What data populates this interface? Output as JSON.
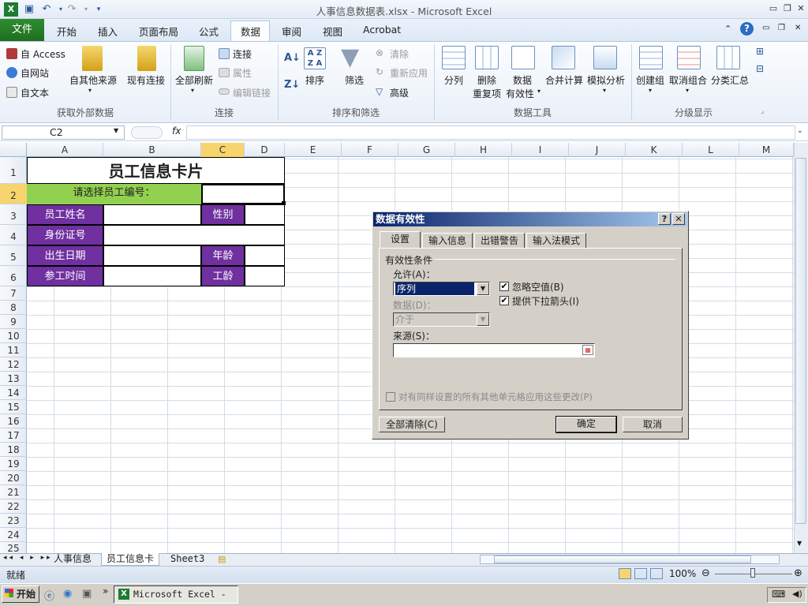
{
  "window": {
    "title": "人事信息数据表.xlsx - Microsoft Excel"
  },
  "ribbon": {
    "tabs": [
      "文件",
      "开始",
      "插入",
      "页面布局",
      "公式",
      "数据",
      "审阅",
      "视图",
      "Acrobat"
    ],
    "active_tab": "数据",
    "groups": {
      "external": {
        "label": "获取外部数据",
        "access": "自 Access",
        "web": "自网站",
        "text": "自文本",
        "other": "自其他来源",
        "existing": "现有连接"
      },
      "connections": {
        "label": "连接",
        "refresh_all": "全部刷新",
        "connections": "连接",
        "properties": "属性",
        "edit_links": "编辑链接"
      },
      "sort_filter": {
        "label": "排序和筛选",
        "sort": "排序",
        "filter": "筛选",
        "clear": "清除",
        "reapply": "重新应用",
        "advanced": "高级"
      },
      "data_tools": {
        "label": "数据工具",
        "split": "分列",
        "remove_dup_1": "删除",
        "remove_dup_2": "重复项",
        "validation_1": "数据",
        "validation_2": "有效性",
        "consolidate": "合并计算",
        "whatif": "模拟分析"
      },
      "outline": {
        "label": "分级显示",
        "group": "创建组",
        "ungroup": "取消组合",
        "subtotal": "分类汇总"
      }
    }
  },
  "formula_bar": {
    "name_box": "C2",
    "fx": "fx",
    "formula": ""
  },
  "columns": [
    "A",
    "B",
    "C",
    "D",
    "E",
    "F",
    "G",
    "H",
    "I",
    "J",
    "K",
    "L",
    "M"
  ],
  "rows": [
    "1",
    "2",
    "3",
    "4",
    "5",
    "6",
    "7",
    "8",
    "9",
    "10",
    "11",
    "12",
    "13",
    "14",
    "15",
    "16",
    "17",
    "18",
    "19",
    "20",
    "21",
    "22",
    "23",
    "24",
    "25"
  ],
  "sheet": {
    "title": "员工信息卡片",
    "prompt": "请选择员工编号：",
    "name": "员工姓名",
    "gender": "性别",
    "id": "身份证号",
    "birth": "出生日期",
    "age": "年龄",
    "join": "参工时间",
    "seniority": "工龄"
  },
  "sheet_tabs": [
    "人事信息",
    "员工信息卡",
    "Sheet3"
  ],
  "active_sheet": "员工信息卡",
  "status": {
    "ready": "就绪",
    "zoom": "100%"
  },
  "taskbar": {
    "start": "开始",
    "item": "Microsoft Excel - ..."
  },
  "dialog": {
    "title": "数据有效性",
    "tabs": [
      "设置",
      "输入信息",
      "出错警告",
      "输入法模式"
    ],
    "section": "有效性条件",
    "allow_label": "允许(A)：",
    "allow_value": "序列",
    "ignore_blank": "忽略空值(B)",
    "dropdown": "提供下拉箭头(I)",
    "data_label": "数据(D)：",
    "data_value": "介于",
    "source_label": "来源(S)：",
    "source_value": "",
    "apply_all": "对有同样设置的所有其他单元格应用这些更改(P)",
    "clear_all": "全部清除(C)",
    "ok": "确定",
    "cancel": "取消"
  },
  "colors": {
    "purple": "#7030a0",
    "green": "#92d050",
    "file_tab": "#1e6e22",
    "selection": "#f7d46d"
  }
}
